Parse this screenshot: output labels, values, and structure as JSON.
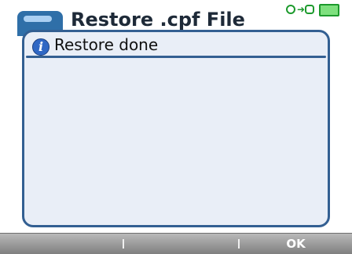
{
  "window": {
    "title": "Restore .cpf File"
  },
  "status_icons": [
    "search-icon",
    "plug-icon",
    "power-icon",
    "battery-icon"
  ],
  "dialog": {
    "title": "Restore done",
    "icon": "info-icon"
  },
  "softkeys": {
    "left_label": "",
    "middle_label": "",
    "right_label": "OK"
  },
  "colors": {
    "dialog_border": "#335f92",
    "dialog_bg": "#e9eef7",
    "info_blue": "#2f67c4",
    "softkey_bar": "#999999",
    "status_green": "#1c9a2c"
  }
}
